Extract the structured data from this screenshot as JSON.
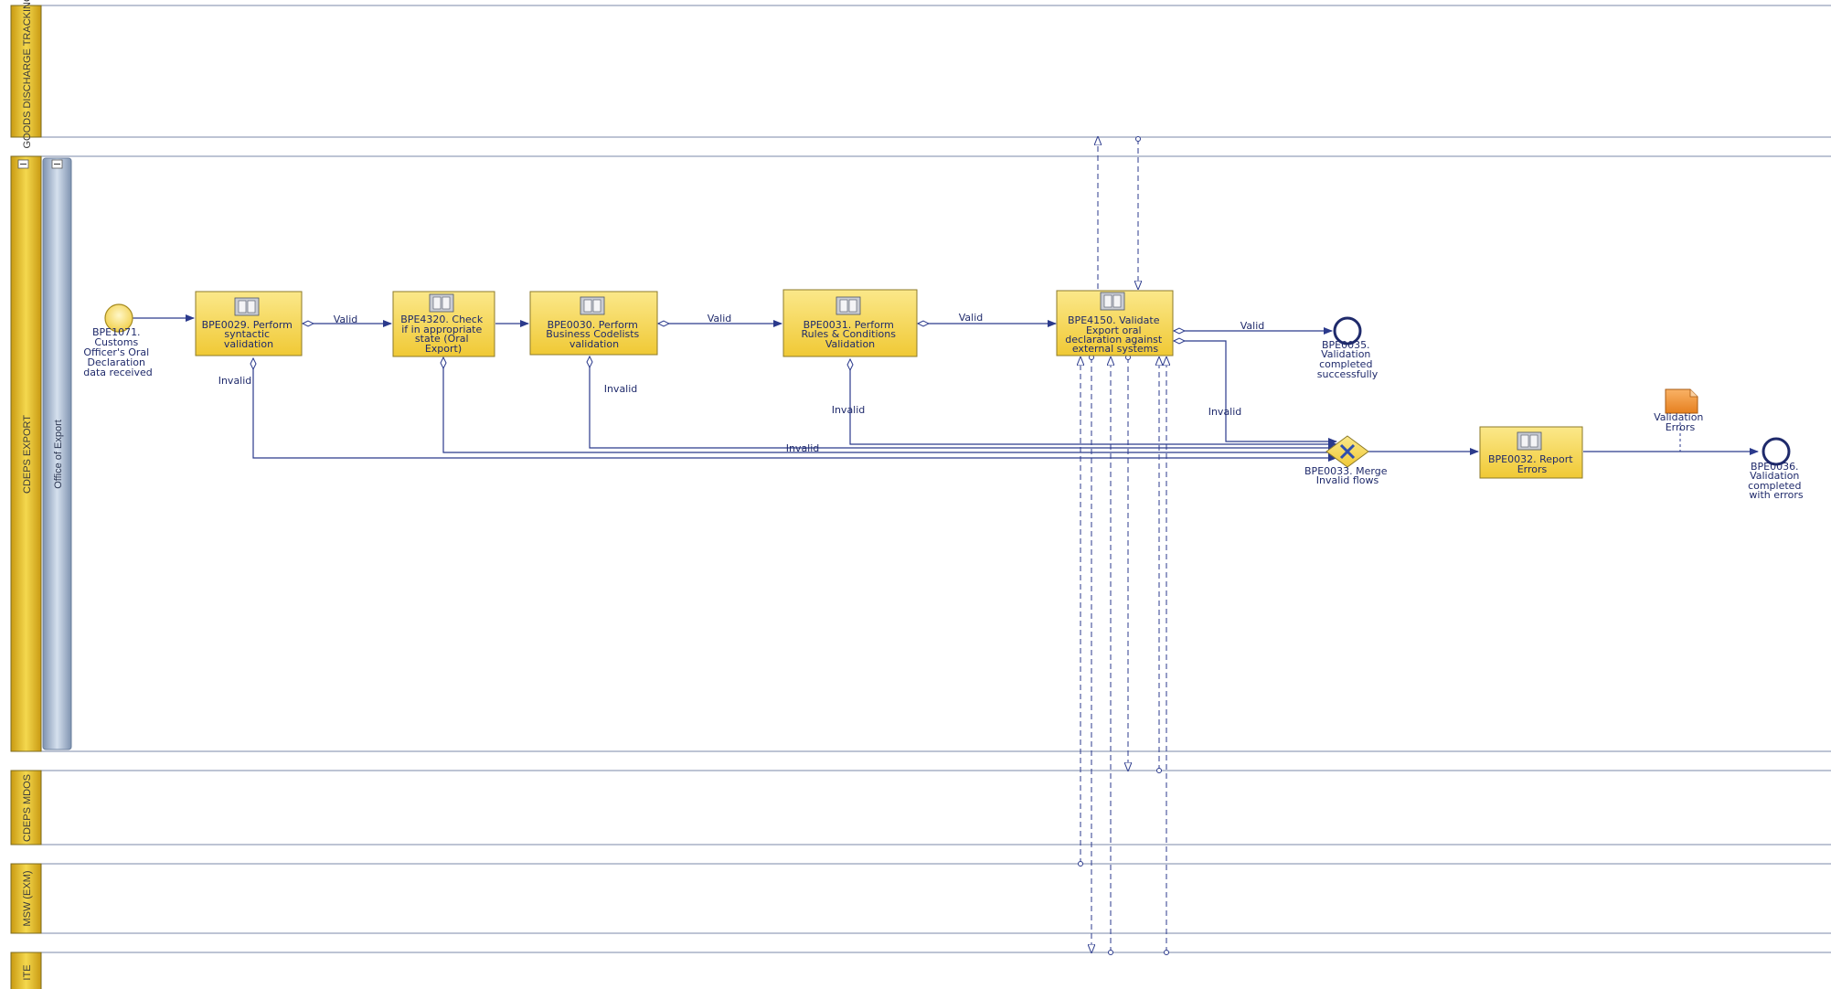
{
  "lanes": {
    "goods_discharge_tracking": "GOODS DISCHARGE TRACKING",
    "cdeps_export": "CDEPS EXPORT",
    "office_of_export": "Office of Export",
    "cdeps_mdos": "CDEPS MDOS",
    "msw_exm": "MSW (EXM)",
    "ite": "ITE"
  },
  "events": {
    "start": [
      "BPE1071.",
      "Customs",
      "Officer's Oral",
      "Declaration",
      "data received"
    ],
    "end_success": [
      "BPE0035.",
      "Validation",
      "completed",
      "successfully"
    ],
    "end_errors": [
      "BPE0036.",
      "Validation",
      "completed",
      "with errors"
    ]
  },
  "tasks": {
    "t1": [
      "BPE0029. Perform",
      "syntactic",
      "validation"
    ],
    "t2": [
      "BPE4320. Check",
      "if in appropriate",
      "state (Oral",
      "Export)"
    ],
    "t3": [
      "BPE0030. Perform",
      "Business Codelists",
      "validation"
    ],
    "t4": [
      "BPE0031. Perform",
      "Rules & Conditions",
      "Validation"
    ],
    "t5": [
      "BPE4150. Validate",
      "Export oral",
      "declaration against",
      "external systems"
    ],
    "t6": [
      "BPE0032. Report",
      "Errors"
    ]
  },
  "gateway": [
    "BPE0033. Merge",
    "Invalid flows"
  ],
  "data_object": [
    "Validation",
    "Errors"
  ],
  "flow_labels": {
    "valid": "Valid",
    "invalid": "Invalid"
  },
  "colors": {
    "lane_header_gold": "#e8c232",
    "subheader_blue": "#a9bdd6",
    "task_fill": "#f6d64a",
    "flow_line": "#2b3a8c",
    "data_object": "#f0923a"
  },
  "icons": {
    "task_icon": "service-task-icon",
    "collapse_icon": "collapse-icon",
    "gateway_icon": "exclusive-gateway-icon"
  }
}
